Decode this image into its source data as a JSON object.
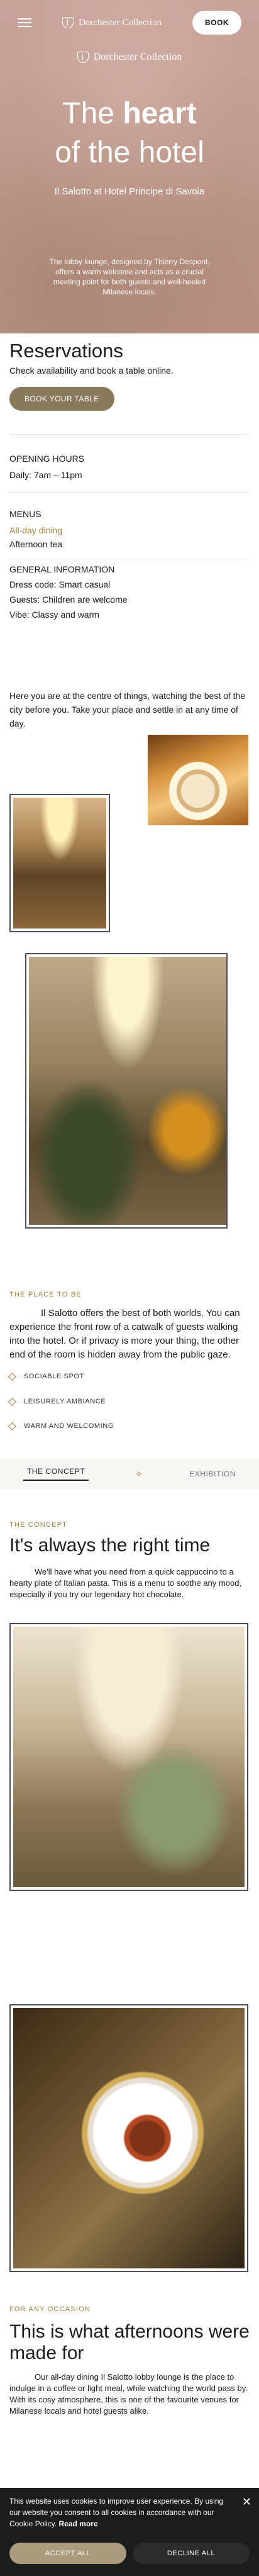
{
  "header": {
    "brand": "Dorchester Collection",
    "book_label": "BOOK"
  },
  "hero": {
    "brand": "Dorchester Collection",
    "title_pre": "The ",
    "title_bold": "heart",
    "title_line2": "of the hotel",
    "subtitle": "Il Salotto at Hotel Principe di Savoia",
    "description": "The lobby lounge, designed by Thierry Despont, offers a warm welcome and acts as a crucial meeting point for both guests and well-heeled Milanese locals."
  },
  "reservations": {
    "title": "Reservations",
    "subtitle": "Check availability and book a table online.",
    "button": "BOOK YOUR TABLE"
  },
  "info": {
    "opening_title": "OPENING HOURS",
    "opening_value": "Daily: 7am – 11pm",
    "menus_title": "MENUS",
    "menu_all_day": "All-day dining",
    "menu_afternoon": "Afternoon tea",
    "general_title": "GENERAL INFORMATION",
    "dress_code": "Dress code: Smart casual",
    "guests": "Guests: Children are welcome",
    "vibe": "Vibe: Classy and warm"
  },
  "intro_text": "Here you are at the centre of things, watching the best of the city before you. Take your place and settle in at any time of day.",
  "place": {
    "label": "THE PLACE TO BE",
    "text": "Il Salotto offers the best of both worlds. You can experience the front row of a catwalk of guests walking into the hotel. Or if privacy is more your thing, the other end of the room is hidden away from the public gaze.",
    "bullets": [
      "SOCIABLE SPOT",
      "LEISURELY AMBIANCE",
      "WARM AND WELCOMING"
    ]
  },
  "tabs": {
    "concept": "THE CONCEPT",
    "exhibition": "EXHIBITION"
  },
  "concept": {
    "label": "THE CONCEPT",
    "title": "It's always the right time",
    "text": "We'll have what you need from a quick cappuccino to a hearty plate of Italian pasta. This is a menu to soothe any mood, especially if you try our legendary hot chocolate."
  },
  "occasion": {
    "label": "FOR ANY OCCASION",
    "title": "This is what afternoons were made for",
    "text": "Our all-day dining Il Salotto lobby lounge is the place to indulge in a coffee or light meal, while watching the world pass by. With its cosy atmosphere, this is one of the favourite venues for Milanese locals and hotel guests alike."
  },
  "cookie": {
    "text": "This website uses cookies to improve user experience. By using our website you consent to all cookies in accordance with our Cookie Policy.",
    "read_more": "Read more",
    "accept": "ACCEPT ALL",
    "decline": "DECLINE ALL"
  },
  "colors": {
    "accent_gold": "#a0843a",
    "button_gold": "#8a7a5c",
    "hero_rose": "#c5a096"
  }
}
